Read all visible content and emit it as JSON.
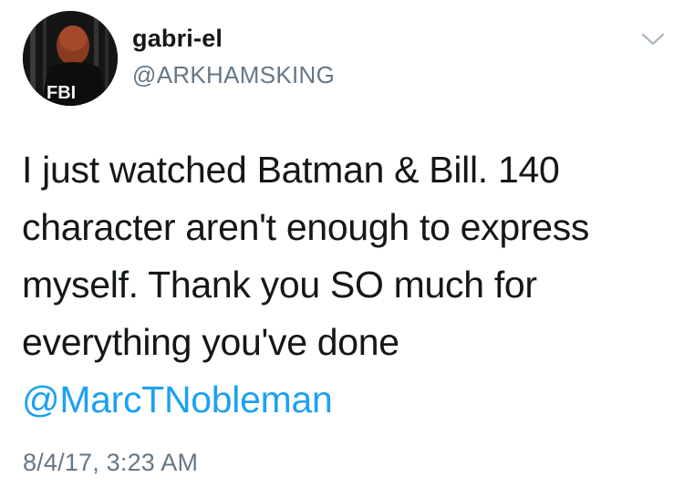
{
  "tweet": {
    "display_name": "gabri-el",
    "handle": "@ARKHAMSKING",
    "avatar": {
      "icon": "profile-photo",
      "badge_text": "FBI"
    },
    "menu_icon": "chevron-down-icon",
    "body_lines": [
      "I just watched Batman & Bill. 140",
      "character aren't enough to express",
      "myself. Thank you SO much for",
      "everything you've done"
    ],
    "mention": "@MarcTNobleman",
    "timestamp": "8/4/17, 3:23 AM"
  },
  "colors": {
    "text": "#14171a",
    "secondary": "#657786",
    "link": "#1da1f2",
    "background": "#ffffff"
  }
}
